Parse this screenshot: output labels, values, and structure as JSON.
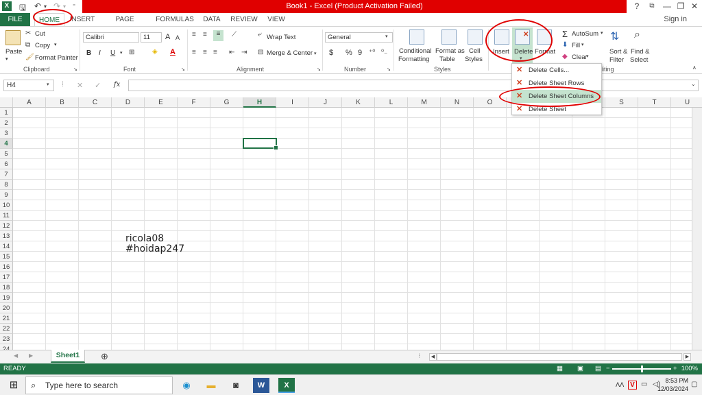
{
  "window": {
    "title": "Book1 -  Excel (Product Activation Failed)",
    "help": "?",
    "ribbon_display": "⧉",
    "minimize": "—",
    "restore": "❐",
    "close": "✕",
    "signin": "Sign in"
  },
  "tabs": [
    "FILE",
    "HOME",
    "INSERT",
    "PAGE LAYOUT",
    "FORMULAS",
    "DATA",
    "REVIEW",
    "VIEW"
  ],
  "clipboard": {
    "paste": "Paste",
    "cut": "Cut",
    "copy": "Copy",
    "format_painter": "Format Painter",
    "label": "Clipboard"
  },
  "font": {
    "name": "Calibri",
    "size": "11",
    "bold": "B",
    "italic": "I",
    "underline": "U",
    "grow": "A",
    "shrink": "A",
    "label": "Font"
  },
  "alignment": {
    "wrap_text": "Wrap Text",
    "merge_center": "Merge & Center",
    "label": "Alignment"
  },
  "number": {
    "format": "General",
    "currency": "$",
    "percent": "%",
    "comma": "9",
    "label": "Number"
  },
  "styles": {
    "conditional": [
      "Conditional",
      "Formatting"
    ],
    "format_table": [
      "Format as",
      "Table"
    ],
    "cell_styles": [
      "Cell",
      "Styles"
    ],
    "label": "Styles"
  },
  "cells": {
    "insert": "Insert",
    "delete": "Delete",
    "format": "Format"
  },
  "editing": {
    "autosum": "AutoSum",
    "fill": "Fill",
    "clear": "Clear",
    "sort_filter": [
      "Sort &",
      "Filter"
    ],
    "find_select": [
      "Find &",
      "Select"
    ],
    "label": "diting"
  },
  "delete_menu": [
    "Delete Cells...",
    "Delete Sheet Rows",
    "Delete Sheet Columns",
    "Delete Sheet"
  ],
  "formula_bar": {
    "name_box": "H4",
    "fx": "fx",
    "cancel": "✕",
    "enter": "✓"
  },
  "grid": {
    "columns": [
      "A",
      "B",
      "C",
      "D",
      "E",
      "F",
      "G",
      "H",
      "I",
      "J",
      "K",
      "L",
      "M",
      "N",
      "O",
      "P",
      "Q",
      "R",
      "S",
      "T",
      "U"
    ],
    "selected_column": "H",
    "rows": [
      "1",
      "2",
      "3",
      "4",
      "5",
      "6",
      "7",
      "8",
      "9",
      "10",
      "11",
      "12",
      "13",
      "14",
      "15",
      "16",
      "17",
      "18",
      "19",
      "20",
      "21",
      "22",
      "23",
      "24"
    ],
    "selected_row": "4",
    "cell_text": [
      "ricola08",
      "#hoidap247"
    ]
  },
  "sheets": {
    "active": "Sheet1",
    "add": "⊕"
  },
  "status": {
    "ready": "READY",
    "zoom": "100%",
    "zoom_minus": "−",
    "zoom_plus": "+"
  },
  "taskbar": {
    "search_placeholder": "Type here to search",
    "time": "8:53 PM",
    "date": "12/03/2024"
  },
  "colors": {
    "excel_green": "#217346",
    "title_red": "#e00000",
    "highlight": "#c5e3cf",
    "annotation": "#e00000"
  }
}
